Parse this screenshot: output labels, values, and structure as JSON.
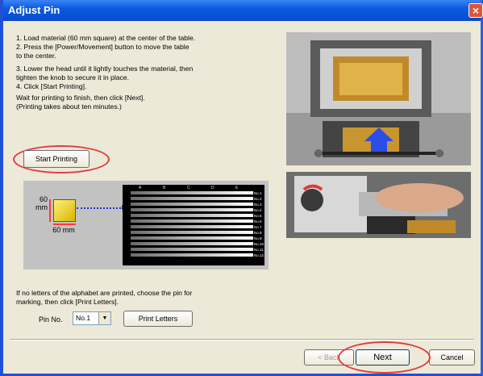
{
  "window": {
    "title": "Adjust Pin",
    "close_glyph": "×"
  },
  "instructions": [
    "1. Load material (60 mm square) at the center of the table.",
    "2. Press the [Power/Movement] button to move the table",
    "to the center.",
    "3. Lower the head until it lightly touches the material, then",
    "tighten the knob to secure it in place.",
    "4. Click [Start Printing].",
    "Wait for printing to finish, then click [Next].",
    "(Printing takes about ten minutes.)"
  ],
  "start_button": {
    "label": "Start Printing"
  },
  "diagram": {
    "dim_vertical": "60\nmm",
    "dim_horizontal": "60 mm",
    "column_headers": [
      "A",
      "B",
      "C",
      "D",
      "E"
    ],
    "pattern_labels": [
      "No.1",
      "No.2",
      "No.3",
      "No.4",
      "No.5",
      "No.6",
      "No.7",
      "No.8",
      "No.9",
      "No.10",
      "No.11",
      "No.12"
    ]
  },
  "no_letters": {
    "line1": "If no letters of the alphabet are printed, choose the pin for",
    "line2": "marking, then click [Print Letters]."
  },
  "pin": {
    "label": "Pin No.",
    "selected": "No.1",
    "arrow": "▼"
  },
  "print_button": {
    "label": "Print Letters"
  },
  "footer": {
    "back_label": "< Back",
    "next_label": "Next",
    "cancel_label": "Cancel"
  },
  "colors": {
    "title_bar": "#0650d6",
    "highlight_ring": "#e23b3b",
    "dialog_bg": "#ece9d8",
    "arrow_blue": "#1a36d6"
  },
  "icons": [
    "close-icon",
    "dropdown-arrow-icon",
    "arrow-up-icon",
    "arrow-right-icon"
  ]
}
